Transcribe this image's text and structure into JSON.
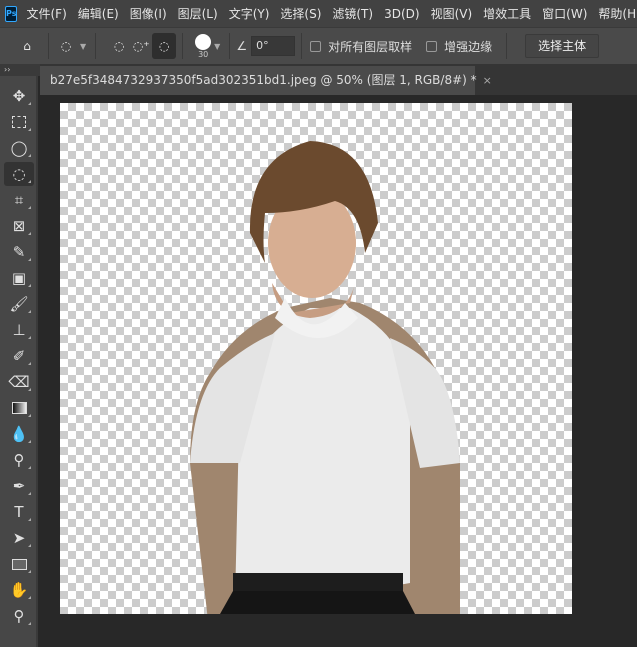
{
  "menubar": {
    "logo": "Ps",
    "items": [
      "文件(F)",
      "编辑(E)",
      "图像(I)",
      "图层(L)",
      "文字(Y)",
      "选择(S)",
      "滤镜(T)",
      "3D(D)",
      "视图(V)",
      "增效工具",
      "窗口(W)",
      "帮助(H)"
    ]
  },
  "options": {
    "brush_size": "30",
    "angle": "0°",
    "sample_all_layers": "对所有图层取样",
    "enhance_edge": "增强边缘",
    "select_subject": "选择主体"
  },
  "document": {
    "tab_title": "b27e5f3484732937350f5ad302351bd1.jpeg @ 50% (图层 1, RGB/8#) *",
    "close": "×"
  },
  "panel_collapse": "››",
  "tools": [
    "move",
    "marquee",
    "lasso",
    "quick-selection",
    "crop",
    "frame",
    "eyedropper",
    "spot-healing",
    "brush",
    "clone-stamp",
    "history-brush",
    "eraser",
    "gradient",
    "blur",
    "dodge",
    "pen",
    "type",
    "path-selection",
    "rectangle",
    "hand",
    "zoom"
  ],
  "active_tool": "quick-selection"
}
